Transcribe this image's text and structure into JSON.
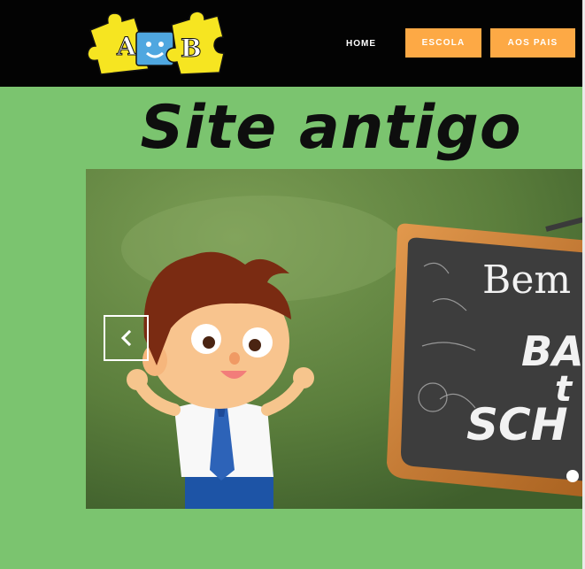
{
  "logo": {
    "letter_left": "A",
    "letter_right": "B"
  },
  "nav": {
    "home": "HOME",
    "escola": "ESCOLA",
    "aos_pais": "AOS PAIS"
  },
  "page_title": "Site antigo",
  "slider": {
    "chalkboard_line1": "Bem",
    "chalkboard_line2": "BA",
    "chalkboard_line3": "t",
    "chalkboard_line4": "SCH",
    "prev_icon": "chevron-left-icon",
    "active_slide": 1
  },
  "colors": {
    "header_bg": "#030303",
    "page_bg": "#7bc46f",
    "nav_button": "#fda945",
    "title_text": "#0e0e0e"
  }
}
